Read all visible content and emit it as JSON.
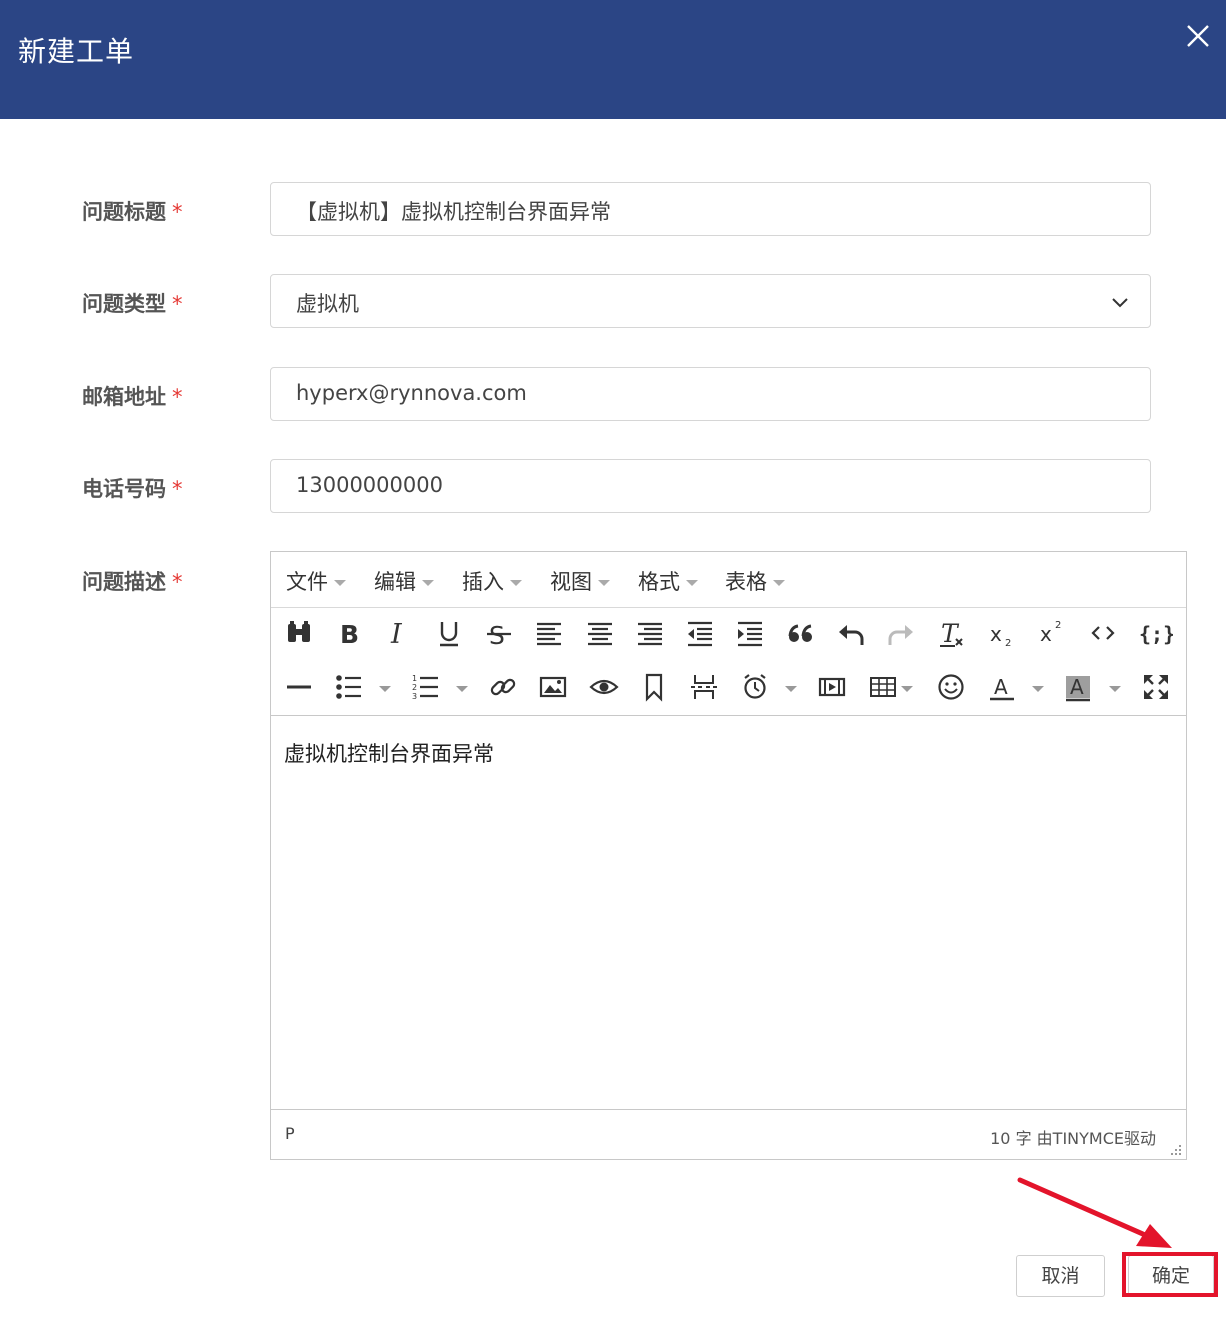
{
  "dialog": {
    "title": "新建工单",
    "close_icon": "close-icon",
    "header_color": "#2b4585"
  },
  "form": {
    "required_mark": "*",
    "fields": {
      "subject": {
        "label": "问题标题",
        "value": "【虚拟机】虚拟机控制台界面异常"
      },
      "type": {
        "label": "问题类型",
        "value": "虚拟机"
      },
      "email": {
        "label": "邮箱地址",
        "value": "hyperx@rynnova.com"
      },
      "phone": {
        "label": "电话号码",
        "value": "13000000000"
      },
      "description": {
        "label": "问题描述"
      }
    }
  },
  "editor": {
    "menus": [
      "文件",
      "编辑",
      "插入",
      "视图",
      "格式",
      "表格"
    ],
    "content": "虚拟机控制台界面异常",
    "path": "P",
    "word_count": "10 字",
    "powered_by": "由TINYMCE驱动"
  },
  "buttons": {
    "cancel": "取消",
    "confirm": "确定"
  },
  "annotation": {
    "highlight_color": "#e3142b"
  }
}
